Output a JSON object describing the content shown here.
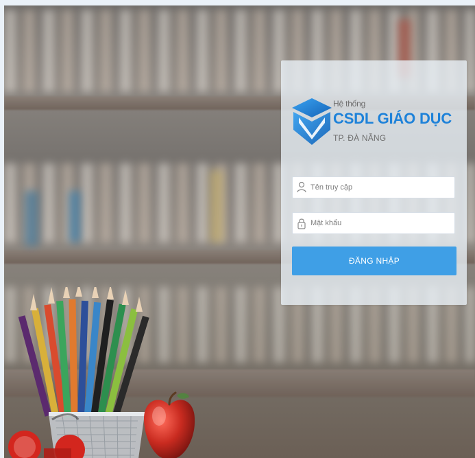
{
  "login": {
    "brand": {
      "prefix": "Hệ thống",
      "name": "CSDL GIÁO DỤC",
      "city": "TP. ĐÀ NẴNG"
    },
    "username": {
      "placeholder": "Tên truy cập",
      "value": ""
    },
    "password": {
      "placeholder": "Mật khẩu",
      "value": ""
    },
    "submit_label": "ĐĂNG NHẬP"
  },
  "icons": {
    "brand_logo": "graduation-cap-icon",
    "username": "user-icon",
    "password": "lock-icon"
  },
  "colors": {
    "brand_blue": "#1e82d9",
    "button_blue": "#3f9fe6",
    "panel_bg": "#ebf2f9"
  }
}
